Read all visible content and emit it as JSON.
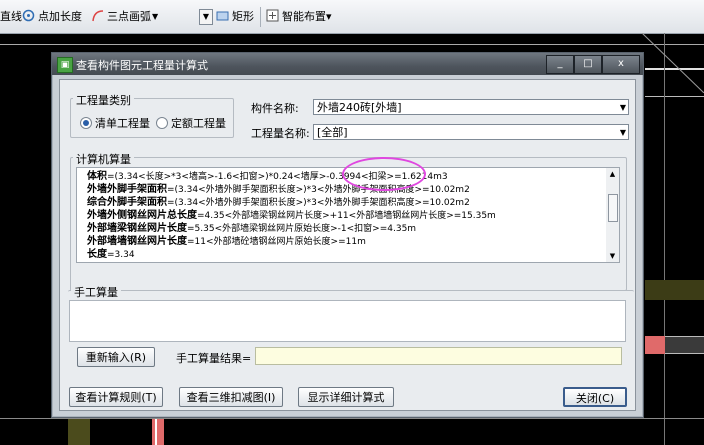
{
  "toolbar": {
    "item1": "直线",
    "item2": "点加长度",
    "item3": "三点画弧",
    "item4": "矩形",
    "item5": "智能布置",
    "item5_arrow": "▾"
  },
  "dialog": {
    "title": "查看构件图元工程量计算式",
    "controls": {
      "minimize": "_",
      "maximize": "□",
      "close": "x"
    },
    "quantity_type": {
      "label": "工程量类别",
      "option1": "清单工程量",
      "option2": "定额工程量",
      "selected": "清单工程量"
    },
    "component_name_label": "构件名称:",
    "component_name_value": "外墙240砖[外墙]",
    "quantity_name_label": "工程量名称:",
    "quantity_name_value": "[全部]",
    "machine_calc": {
      "label": "计算机算量",
      "lines": [
        {
          "name": "体积",
          "formula": "=(3.34<长度>*3<墙高>-1.6<扣窗>)*0.24<墙厚>-0.3994<扣梁>=1.6214m3"
        },
        {
          "name": "外墙外脚手架面积",
          "formula": "=(3.34<外墙外脚手架面积长度>)*3<外墙外脚手架面积高度>=10.02m2"
        },
        {
          "name": "综合外脚手架面积",
          "formula": "=(3.34<外墙外脚手架面积长度>)*3<外墙外脚手架面积高度>=10.02m2"
        },
        {
          "name": "外墙外侧钢丝网片总长度",
          "formula": "=4.35<外部墙梁钢丝网片长度>+11<外部墙墙钢丝网片长度>=15.35m"
        },
        {
          "name": "外部墙梁钢丝网片长度",
          "formula": "=5.35<外部墙梁钢丝网片原始长度>-1<扣窗>=4.35m"
        },
        {
          "name": "外部墙墙钢丝网片长度",
          "formula": "=11<外部墙砼墙钢丝网片原始长度>=11m"
        },
        {
          "name": "长度",
          "formula": "=3.34"
        }
      ]
    },
    "manual_calc": {
      "label": "手工算量",
      "reinput_button": "重新输入(R)",
      "result_label": "手工算量结果=",
      "result_value": ""
    },
    "buttons": {
      "view_rules": "查看计算规则(T)",
      "view_3d": "查看三维扣减图(I)",
      "show_detail": "显示详细计算式",
      "close": "关闭(C)"
    }
  },
  "colors": {
    "canvas": "#000000",
    "annotation_circle": "#e047e0",
    "dialog_titlebar": "#4e555d",
    "result_field": "#fdfde0"
  }
}
